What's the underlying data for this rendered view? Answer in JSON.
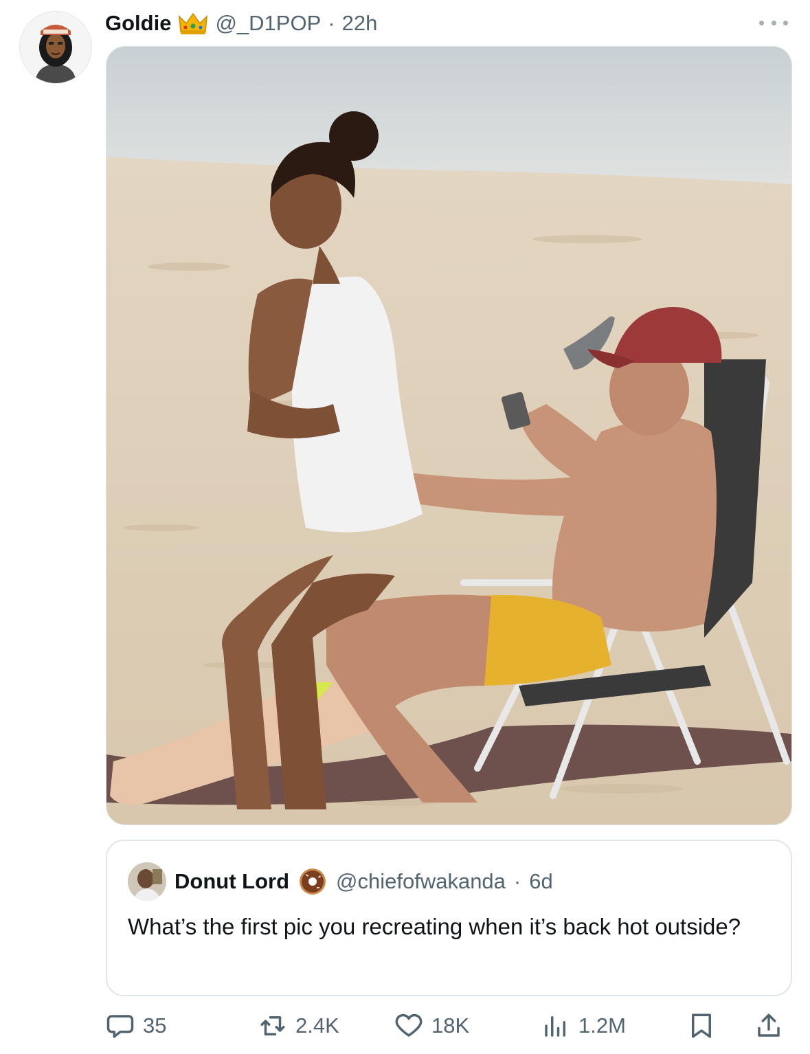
{
  "tweet": {
    "author": {
      "display_name": "Goldie",
      "handle": "@_D1POP",
      "time": "22h",
      "badge_icon": "crown-emoji-icon"
    },
    "separator": "·"
  },
  "quote": {
    "author": {
      "display_name": "Donut Lord",
      "handle": "@chiefofwakanda",
      "time": "6d",
      "badge_icon": "donut-emoji-icon"
    },
    "separator": "·",
    "text": "What’s the first pic you recreating when it’s back hot outside?"
  },
  "actions": {
    "replies": "35",
    "reposts": "2.4K",
    "likes": "18K",
    "views": "1.2M"
  },
  "colors": {
    "text": "#0f1419",
    "muted": "#536471",
    "border": "#e1e6ea"
  }
}
